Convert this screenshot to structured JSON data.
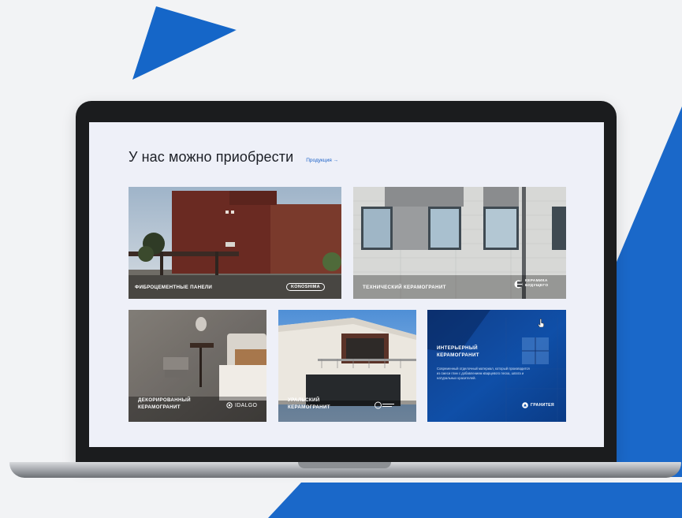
{
  "page": {
    "title": "У нас можно приобрести",
    "products_link": "Продукция →"
  },
  "cards": [
    {
      "title": "ФИБРОЦЕМЕНТНЫЕ ПАНЕЛИ",
      "brand": "KONOSHIMA"
    },
    {
      "title": "ТЕХНИЧЕСКИЙ КЕРАМОГРАНИТ",
      "brand_line1": "КЕРАМИКА",
      "brand_line2": "БУДУЩЕГО"
    },
    {
      "title_line1": "ДЕКОРИРОВАННЫЙ",
      "title_line2": "КЕРАМОГРАНИТ",
      "brand": "IDALGO"
    },
    {
      "title_line1": "УРАЛЬСКИЙ",
      "title_line2": "КЕРАМОГРАНИТ"
    },
    {
      "title_line1": "ИНТЕРЬЕРНЫЙ",
      "title_line2": "КЕРАМОГРАНИТ",
      "description": "Современный отделочный материал, который производится из смеси глин с добавлением кварцевого песка, шпата и натуральных красителей.",
      "brand": "ГРАНИТЕЯ"
    }
  ],
  "colors": {
    "accent": "#1a68c9",
    "screen_bg": "#eef0f8"
  }
}
